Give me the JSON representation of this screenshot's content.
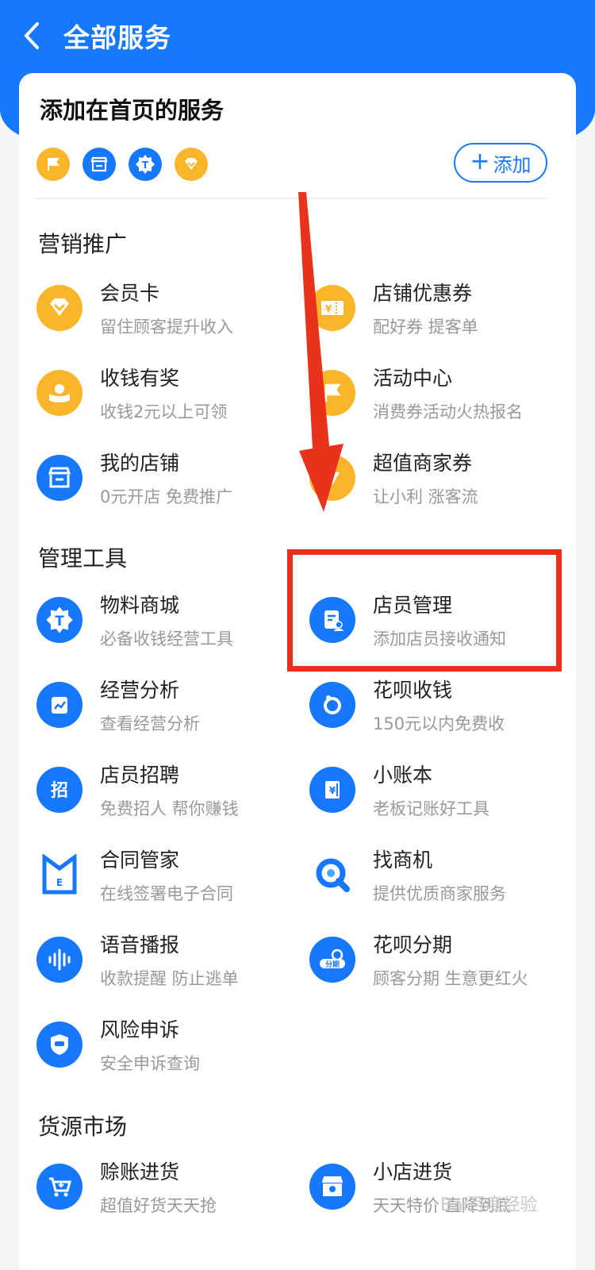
{
  "header": {
    "title": "全部服务"
  },
  "favorites": {
    "title": "添加在首页的服务",
    "add_label": "添加",
    "icons": [
      "flag-icon",
      "store-icon",
      "badge-t-icon",
      "diamond-icon"
    ]
  },
  "sections": {
    "marketing": {
      "title": "营销推广",
      "items": [
        {
          "name": "会员卡",
          "desc": "留住顾客提升收入",
          "icon": "member-card-icon"
        },
        {
          "name": "店铺优惠券",
          "desc": "配好券 提客单",
          "icon": "coupon-icon"
        },
        {
          "name": "收钱有奖",
          "desc": "收钱2元以上可领",
          "icon": "reward-icon"
        },
        {
          "name": "活动中心",
          "desc": "消费券活动火热报名",
          "icon": "flag-icon"
        },
        {
          "name": "我的店铺",
          "desc": "0元开店 免费推广",
          "icon": "store-icon"
        },
        {
          "name": "超值商家券",
          "desc": "让小利 涨客流",
          "icon": "merchant-coupon-icon"
        }
      ]
    },
    "management": {
      "title": "管理工具",
      "items": [
        {
          "name": "物料商城",
          "desc": "必备收钱经营工具",
          "icon": "badge-t-icon"
        },
        {
          "name": "店员管理",
          "desc": "添加店员接收通知",
          "icon": "staff-icon"
        },
        {
          "name": "经营分析",
          "desc": "查看经营分析",
          "icon": "analytics-icon"
        },
        {
          "name": "花呗收钱",
          "desc": "150元以内免费收",
          "icon": "huabei-icon"
        },
        {
          "name": "店员招聘",
          "desc": "免费招人 帮你赚钱",
          "icon": "recruit-icon"
        },
        {
          "name": "小账本",
          "desc": "老板记账好工具",
          "icon": "ledger-icon"
        },
        {
          "name": "合同管家",
          "desc": "在线签署电子合同",
          "icon": "contract-icon"
        },
        {
          "name": "找商机",
          "desc": "提供优质商家服务",
          "icon": "opportunity-icon"
        },
        {
          "name": "语音播报",
          "desc": "收款提醒 防止逃单",
          "icon": "voice-icon"
        },
        {
          "name": "花呗分期",
          "desc": "顾客分期 生意更红火",
          "icon": "installment-icon"
        },
        {
          "name": "风险申诉",
          "desc": "安全申诉查询",
          "icon": "shield-icon"
        }
      ]
    },
    "supply": {
      "title": "货源市场",
      "items": [
        {
          "name": "赊账进货",
          "desc": "超值好货天天抢",
          "icon": "cart-icon"
        },
        {
          "name": "小店进货",
          "desc": "天天特价 直降到底",
          "icon": "shop-stock-icon"
        }
      ]
    }
  },
  "watermark": "Bai百度经验",
  "colors": {
    "brand_blue": "#1677ff",
    "accent_orange": "#fbb52b",
    "highlight_red": "#e8321c"
  }
}
